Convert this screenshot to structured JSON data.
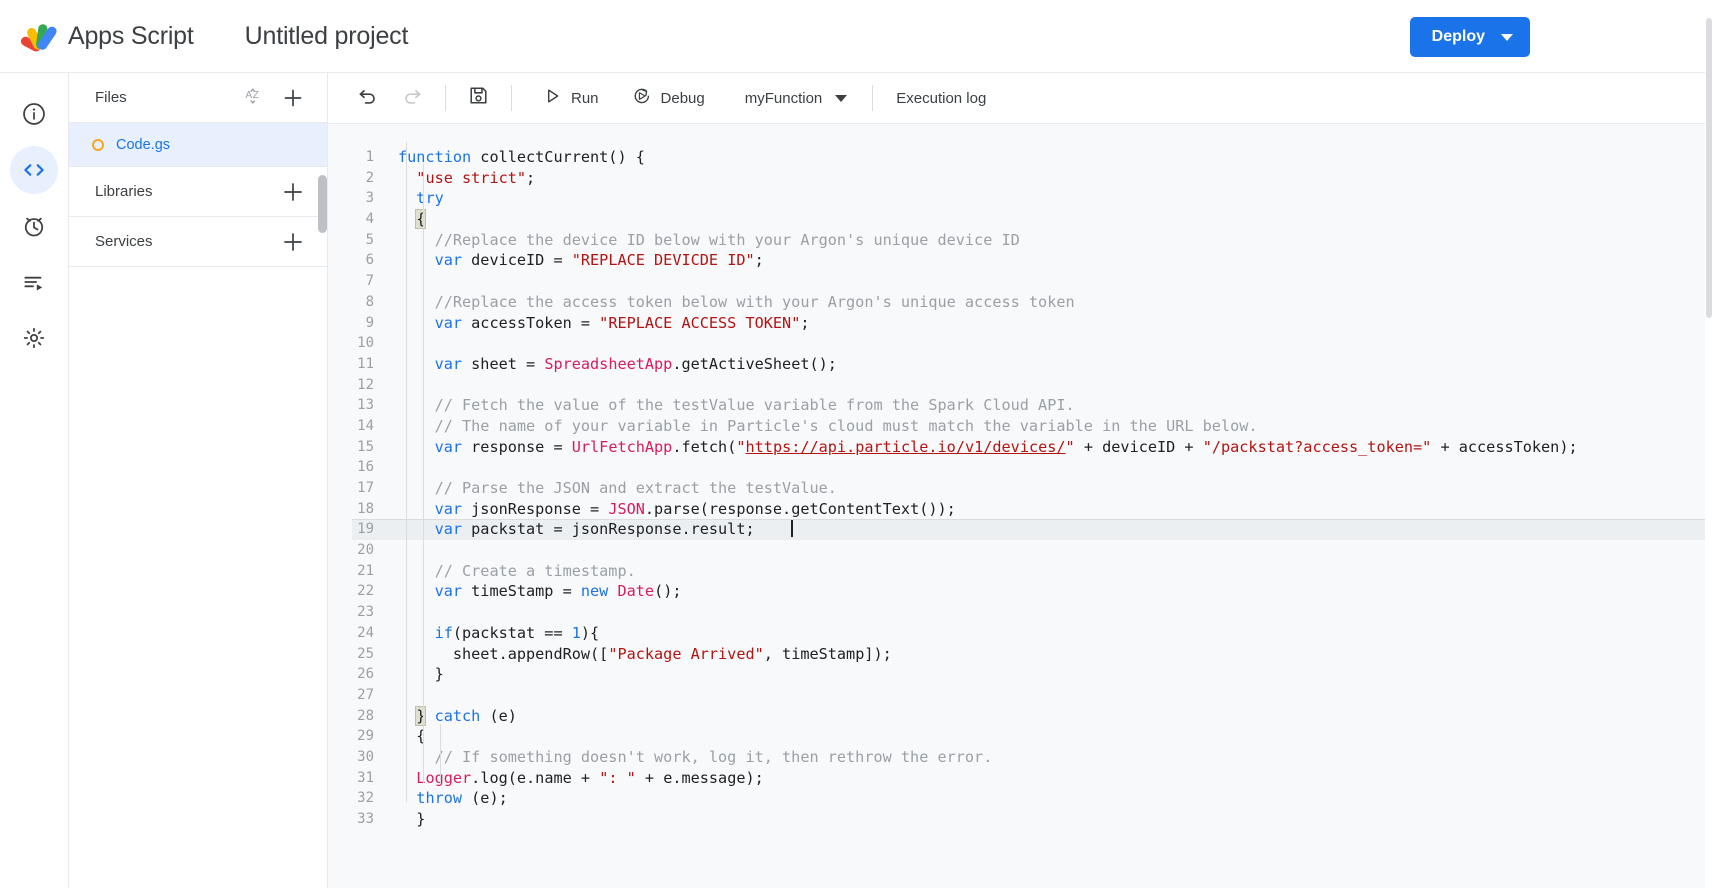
{
  "header": {
    "app_name": "Apps Script",
    "project_title": "Untitled project",
    "logo_icon": "apps-script-logo",
    "deploy_label": "Deploy",
    "deploy_caret_icon": "chevron-down-icon",
    "deploy_color": "#1a73e8"
  },
  "rail": {
    "items": [
      {
        "icon": "info-icon",
        "name": "overview",
        "active": false
      },
      {
        "icon": "code-icon",
        "name": "editor",
        "active": true
      },
      {
        "icon": "alarm-clock-icon",
        "name": "triggers",
        "active": false
      },
      {
        "icon": "execution-list-icon",
        "name": "executions",
        "active": false
      },
      {
        "icon": "gear-icon",
        "name": "project-settings",
        "active": false
      }
    ]
  },
  "sidebar": {
    "sections": [
      {
        "title": "Files",
        "actions": [
          "sort-az-icon",
          "add-icon"
        ]
      },
      {
        "title": "Libraries",
        "actions": [
          "add-icon"
        ]
      },
      {
        "title": "Services",
        "actions": [
          "add-icon"
        ]
      }
    ],
    "files": [
      {
        "name": "Code.gs",
        "status_icon": "unsaved-dot-icon",
        "selected": true
      }
    ]
  },
  "toolbar": {
    "undo_icon": "undo-icon",
    "redo_icon": "redo-icon",
    "save_icon": "save-icon",
    "run_label": "Run",
    "run_icon": "play-icon",
    "debug_label": "Debug",
    "debug_icon": "debug-icon",
    "function_selected": "myFunction",
    "function_caret_icon": "chevron-down-icon",
    "execution_log_label": "Execution log"
  },
  "editor": {
    "active_line": 19,
    "colors": {
      "keyword": "#1a73e8",
      "string": "#b31412",
      "comment": "#9aa0a6",
      "class": "#d81b60",
      "background": "#f8f9fa"
    },
    "lines": [
      {
        "n": 1,
        "text": "function collectCurrent() {"
      },
      {
        "n": 2,
        "text": "  \"use strict\";"
      },
      {
        "n": 3,
        "text": "  try"
      },
      {
        "n": 4,
        "text": "  {"
      },
      {
        "n": 5,
        "text": "    //Replace the device ID below with your Argon's unique device ID"
      },
      {
        "n": 6,
        "text": "    var deviceID = \"REPLACE DEVICDE ID\";"
      },
      {
        "n": 7,
        "text": ""
      },
      {
        "n": 8,
        "text": "    //Replace the access token below with your Argon's unique access token"
      },
      {
        "n": 9,
        "text": "    var accessToken = \"REPLACE ACCESS TOKEN\";"
      },
      {
        "n": 10,
        "text": ""
      },
      {
        "n": 11,
        "text": "    var sheet = SpreadsheetApp.getActiveSheet();"
      },
      {
        "n": 12,
        "text": ""
      },
      {
        "n": 13,
        "text": "    // Fetch the value of the testValue variable from the Spark Cloud API."
      },
      {
        "n": 14,
        "text": "    // The name of your variable in Particle's cloud must match the variable in the URL below."
      },
      {
        "n": 15,
        "text": "    var response = UrlFetchApp.fetch(\"https://api.particle.io/v1/devices/\" + deviceID + \"/packstat?access_token=\" + accessToken);"
      },
      {
        "n": 16,
        "text": ""
      },
      {
        "n": 17,
        "text": "    // Parse the JSON and extract the testValue."
      },
      {
        "n": 18,
        "text": "    var jsonResponse = JSON.parse(response.getContentText());"
      },
      {
        "n": 19,
        "text": "    var packstat = jsonResponse.result;"
      },
      {
        "n": 20,
        "text": ""
      },
      {
        "n": 21,
        "text": "    // Create a timestamp."
      },
      {
        "n": 22,
        "text": "    var timeStamp = new Date();"
      },
      {
        "n": 23,
        "text": ""
      },
      {
        "n": 24,
        "text": "    if(packstat == 1){"
      },
      {
        "n": 25,
        "text": "      sheet.appendRow([\"Package Arrived\", timeStamp]);"
      },
      {
        "n": 26,
        "text": "    }"
      },
      {
        "n": 27,
        "text": ""
      },
      {
        "n": 28,
        "text": "  } catch (e)"
      },
      {
        "n": 29,
        "text": "  {"
      },
      {
        "n": 30,
        "text": "    // If something doesn't work, log it, then rethrow the error."
      },
      {
        "n": 31,
        "text": "  Logger.log(e.name + \": \" + e.message);"
      },
      {
        "n": 32,
        "text": "  throw (e);"
      },
      {
        "n": 33,
        "text": "  }"
      }
    ]
  }
}
